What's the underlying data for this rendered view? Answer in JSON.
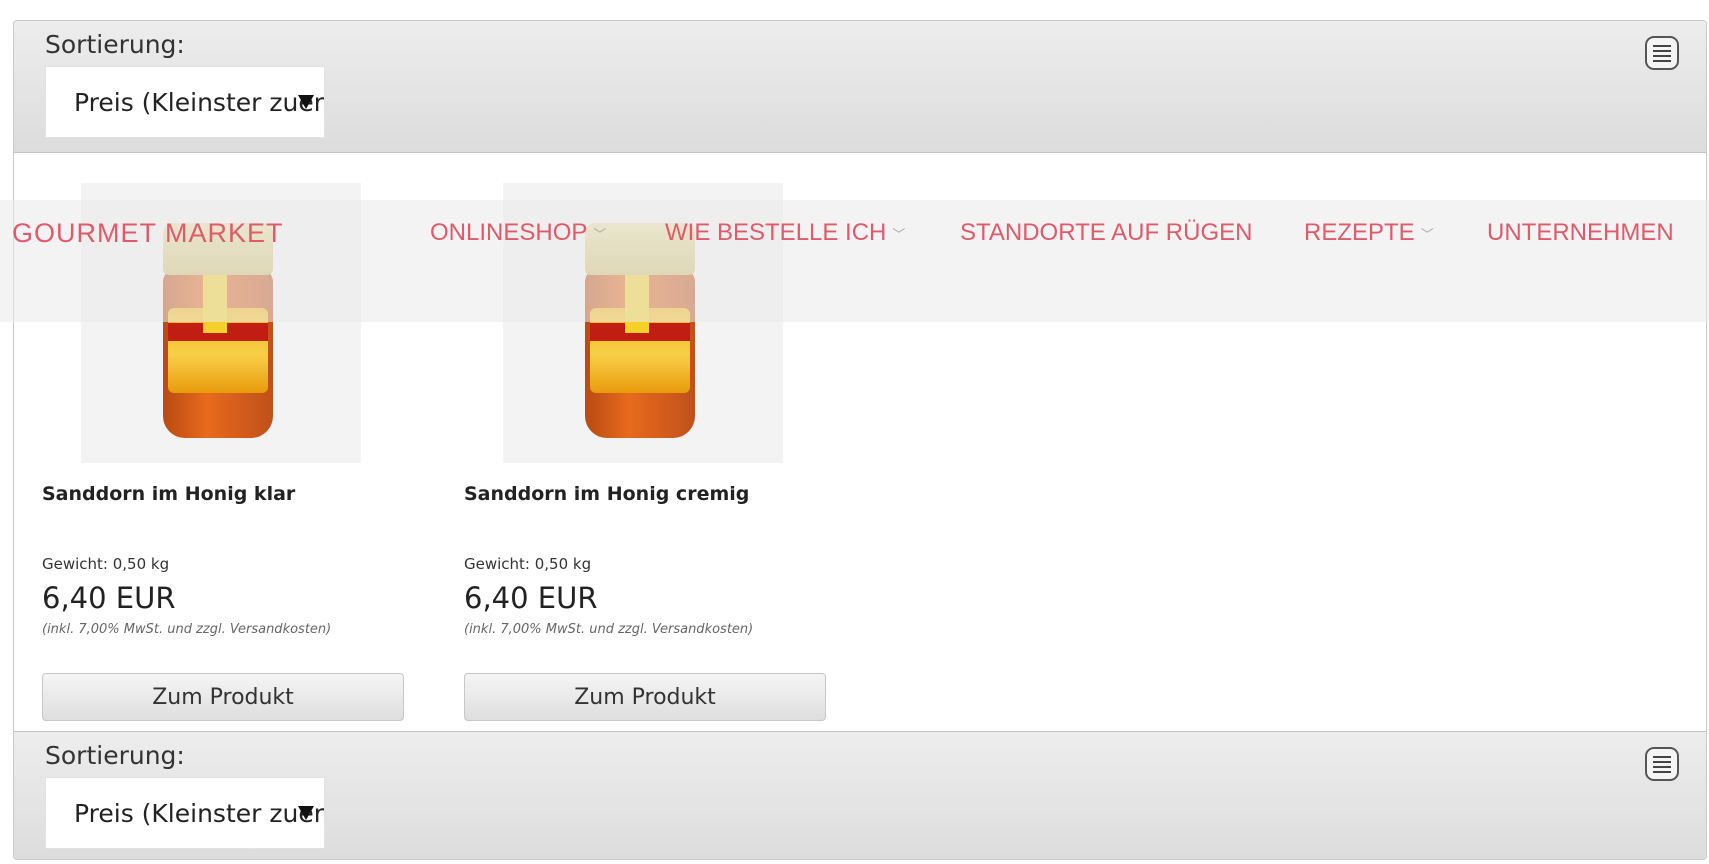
{
  "sort_top": {
    "label": "Sortierung:",
    "selected": "Preis (Kleinster zuerst)"
  },
  "sort_bottom": {
    "label": "Sortierung:",
    "selected": "Preis (Kleinster zuerst)"
  },
  "products": [
    {
      "name": "Sanddorn im Honig klar",
      "weight": "Gewicht: 0,50 kg",
      "price": "6,40 EUR",
      "tax_note": "(inkl. 7,00% MwSt. und zzgl. Versandkosten)",
      "button": "Zum Produkt"
    },
    {
      "name": "Sanddorn im Honig cremig",
      "weight": "Gewicht: 0,50 kg",
      "price": "6,40 EUR",
      "tax_note": "(inkl. 7,00% MwSt. und zzgl. Versandkosten)",
      "button": "Zum Produkt"
    }
  ],
  "nav": {
    "logo": "GOURMET  MARKET",
    "items": [
      {
        "label": "ONLINESHOP",
        "has_dropdown": true
      },
      {
        "label": "WIE BESTELLE ICH",
        "has_dropdown": true
      },
      {
        "label": "STANDORTE AUF RÜGEN",
        "has_dropdown": false
      },
      {
        "label": "REZEPTE",
        "has_dropdown": true
      },
      {
        "label": "UNTERNEHMEN",
        "has_dropdown": false
      }
    ],
    "color": "#df5a6a"
  }
}
